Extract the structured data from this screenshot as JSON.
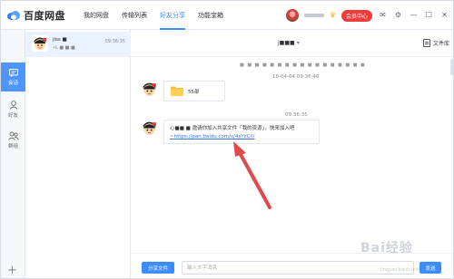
{
  "app": {
    "title": "百度网盘",
    "colors": {
      "accent": "#3b8cff",
      "vip": "#ef3b3b",
      "rail_active": "#4f95ff",
      "arrow": "#e04a4a"
    }
  },
  "nav": {
    "items": [
      {
        "label": "我的网盘",
        "active": false
      },
      {
        "label": "传输列表",
        "active": false
      },
      {
        "label": "好友分享",
        "active": true
      },
      {
        "label": "功能宝箱",
        "active": false
      }
    ]
  },
  "topbar_right": {
    "vip_label": "会员中心",
    "icons": [
      "avatar",
      "crown-icon",
      "mail-icon",
      "settings-icon",
      "minimize-icon",
      "maximize-icon",
      "close-icon"
    ]
  },
  "rail": {
    "items": [
      {
        "label": "会话",
        "icon": "chat-icon",
        "active": true
      },
      {
        "label": "好友",
        "icon": "person-icon",
        "active": false
      },
      {
        "label": "群组",
        "icon": "group-icon",
        "active": false
      }
    ],
    "add": "+"
  },
  "conversations": [
    {
      "name": "jiss ■",
      "preview": "•L  ■  ■ ■",
      "time": "09:36:35"
    }
  ],
  "chat": {
    "title": "j■■■",
    "library_label": "文件库",
    "subtitle": "■ ■ ■ ■ ■ ■ ■ ■ ■ ■ ■ ■ ■ ■ ■ ■ ■",
    "messages": [
      {
        "timestamp": "18-04-04  09:36:46",
        "type": "folder",
        "folder_name": "55部"
      },
      {
        "timestamp": "09:36:35",
        "type": "text",
        "text": "心■■ ■ 邀请你加入共享文件「我的资源」，快来加入吧",
        "link": "~https://pan.baidu.com/s/4sYzC/l/"
      }
    ]
  },
  "composer": {
    "share_label": "分享文件",
    "placeholder": "输入文字消息",
    "send_label": "发送"
  },
  "watermark": {
    "text": "Bai经验",
    "sub": "jingyan.baidu.com"
  }
}
